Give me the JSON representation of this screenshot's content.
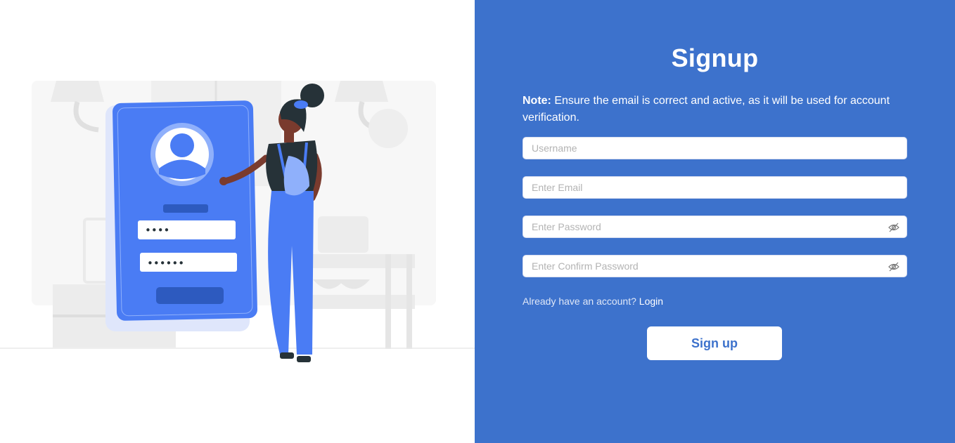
{
  "illustration": {
    "masked_pin_short": "••••",
    "masked_pin_long": "••••••"
  },
  "form": {
    "title": "Signup",
    "note_label": "Note:",
    "note_text": " Ensure the email is correct and active, as it will be used for account verification.",
    "username_placeholder": "Username",
    "email_placeholder": "Enter Email",
    "password_placeholder": "Enter Password",
    "confirm_password_placeholder": "Enter Confirm Password",
    "already_text": "Already have an account? ",
    "login_link": "Login",
    "signup_button": "Sign up"
  },
  "colors": {
    "panel_blue": "#3d72cc",
    "accent_blue": "#4a7cf4",
    "white": "#ffffff"
  }
}
